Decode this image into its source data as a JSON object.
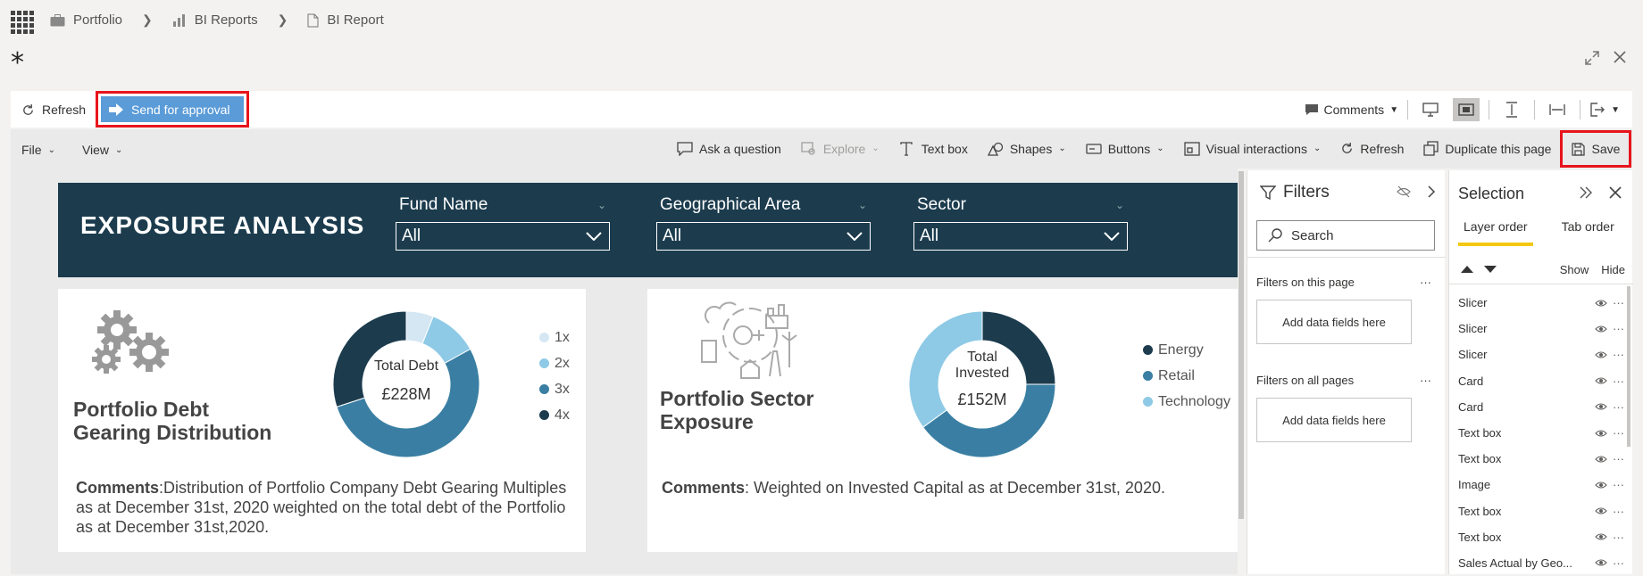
{
  "breadcrumb": {
    "items": [
      {
        "label": "Portfolio",
        "icon": "briefcase-icon"
      },
      {
        "label": "BI Reports",
        "icon": "bar-chart-icon"
      },
      {
        "label": "BI Report",
        "icon": "document-icon"
      }
    ]
  },
  "page": {
    "title_marker": "*"
  },
  "actionbar": {
    "refresh_label": "Refresh",
    "approval_label": "Send for approval",
    "comments_label": "Comments"
  },
  "ribbon": {
    "file_label": "File",
    "view_label": "View",
    "ask_label": "Ask a question",
    "explore_label": "Explore",
    "textbox_label": "Text box",
    "shapes_label": "Shapes",
    "buttons_label": "Buttons",
    "visual_interactions_label": "Visual interactions",
    "refresh_label": "Refresh",
    "duplicate_label": "Duplicate this page",
    "save_label": "Save"
  },
  "report": {
    "title": "EXPOSURE ANALYSIS",
    "slicers": [
      {
        "label": "Fund Name",
        "value": "All"
      },
      {
        "label": "Geographical Area",
        "value": "All"
      },
      {
        "label": "Sector",
        "value": "All"
      }
    ],
    "card1": {
      "title_line1": "Portfolio Debt",
      "title_line2": "Gearing Distribution",
      "center_label": "Total Debt",
      "center_value": "£228M",
      "comment_bold": "Comments",
      "comment_text": ":Distribution of Portfolio Company Debt Gearing Multiples as at December 31st, 2020 weighted on the total debt of the Portfolio as at December 31st,2020."
    },
    "card2": {
      "title_line1": "Portfolio Sector",
      "title_line2": "Exposure",
      "center_label_line1": "Total",
      "center_label_line2": "Invested",
      "center_value": "£152M",
      "comment_bold": "Comments",
      "comment_text": ": Weighted on Invested Capital as at December 31st, 2020."
    }
  },
  "chart_data": [
    {
      "type": "pie",
      "categories": [
        "1x",
        "2x",
        "3x",
        "4x"
      ],
      "values": [
        6,
        11,
        53,
        30
      ],
      "colors": [
        "#d4e7f3",
        "#8ecae6",
        "#3a7fa3",
        "#1c3c4e"
      ]
    },
    {
      "type": "pie",
      "categories": [
        "Energy",
        "Retail",
        "Technology"
      ],
      "values": [
        25,
        40,
        35
      ],
      "colors": [
        "#1c3c4e",
        "#3a7fa3",
        "#8ecae6"
      ]
    }
  ],
  "filters": {
    "title": "Filters",
    "search_placeholder": "Search",
    "on_page_label": "Filters on this page",
    "on_all_label": "Filters on all pages",
    "drop_label": "Add data fields here",
    "more": "···"
  },
  "selection": {
    "title": "Selection",
    "tab_layer": "Layer order",
    "tab_tab": "Tab order",
    "show_label": "Show",
    "hide_label": "Hide",
    "layers": [
      "Slicer",
      "Slicer",
      "Slicer",
      "Card",
      "Card",
      "Text box",
      "Text box",
      "Image",
      "Text box",
      "Text box",
      "Sales Actual by Geo..."
    ],
    "more": "···"
  },
  "colors": {
    "accent_blue": "#5a9bd8",
    "highlight_red": "#e8141c",
    "header_navy": "#1c3c4e",
    "tab_underline": "#f2c811"
  }
}
